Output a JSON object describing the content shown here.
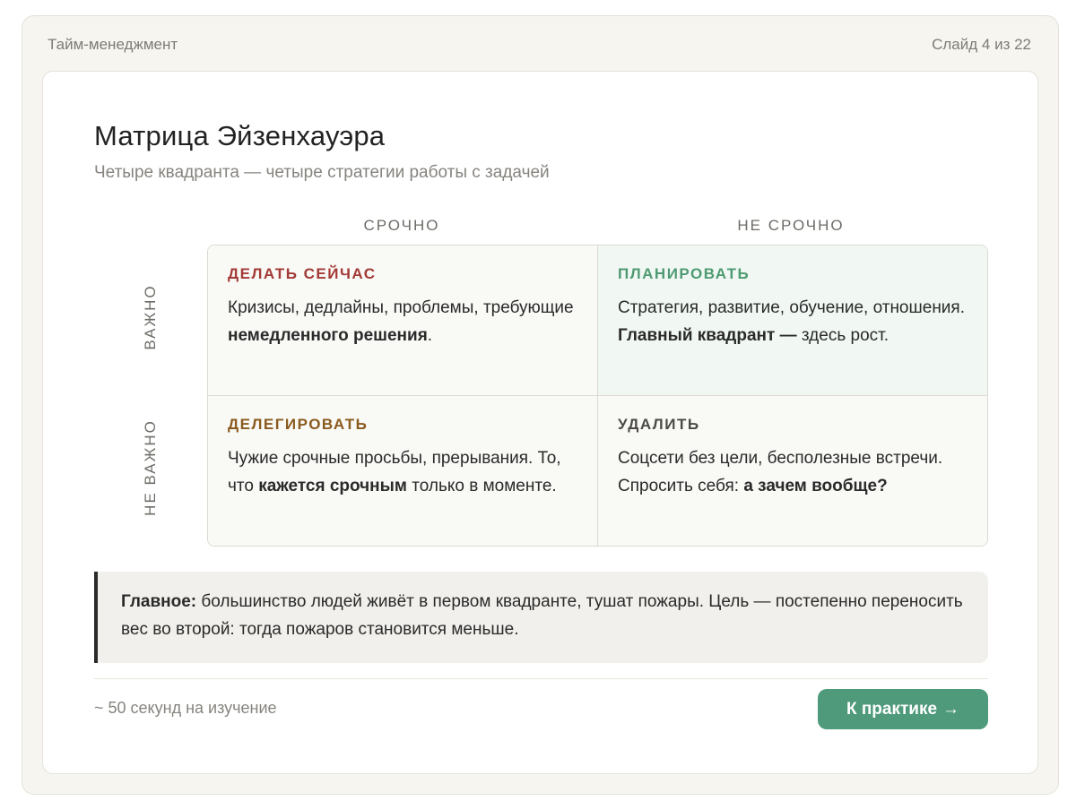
{
  "header": {
    "course": "Тайм-менеджмент",
    "slide_counter": "Слайд 4 из 22"
  },
  "slide": {
    "title": "Матрица Эйзенхауэра",
    "subtitle": "Четыре квадранта — четыре стратегии работы с задачей"
  },
  "matrix": {
    "columns": [
      "СРОЧНО",
      "НЕ СРОЧНО"
    ],
    "rows": [
      "ВАЖНО",
      "НЕ ВАЖНО"
    ],
    "quadrants": [
      {
        "label": "ДЕЛАТЬ СЕЙЧАС",
        "color": "#a33a36",
        "text_before": "Кризисы, дедлайны, проблемы, требующие ",
        "text_bold": "немедленного решения",
        "text_after": "."
      },
      {
        "label": "ПЛАНИРОВАТЬ",
        "color": "#4e9a72",
        "text_before": "Стратегия, развитие, обучение, отношения. ",
        "text_bold": "Главный квадрант —",
        "text_after": " здесь рост."
      },
      {
        "label": "ДЕЛЕГИРОВАТЬ",
        "color": "#8a5a1e",
        "text_before": "Чужие срочные просьбы, прерывания. То, что ",
        "text_bold": "кажется срочным",
        "text_after": " только в моменте."
      },
      {
        "label": "УДАЛИТЬ",
        "color": "#4c4a46",
        "text_before": "Соцсети без цели, бесполезные встречи. Спросить себя: ",
        "text_bold": "а зачем вообще?",
        "text_after": ""
      }
    ]
  },
  "callout": {
    "bold": "Главное:",
    "text": " большинство людей живёт в первом квадранте, тушат пожары. Цель — постепенно переносить вес во второй: тогда пожаров становится меньше."
  },
  "footer": {
    "time_estimate": "~ 50 секунд на изучение",
    "cta_label": "К практике",
    "cta_icon": "arrow-right-icon",
    "cta_arrow": "→"
  },
  "colors": {
    "accent": "#4e9a7b",
    "frame_bg": "#f6f5f0"
  }
}
